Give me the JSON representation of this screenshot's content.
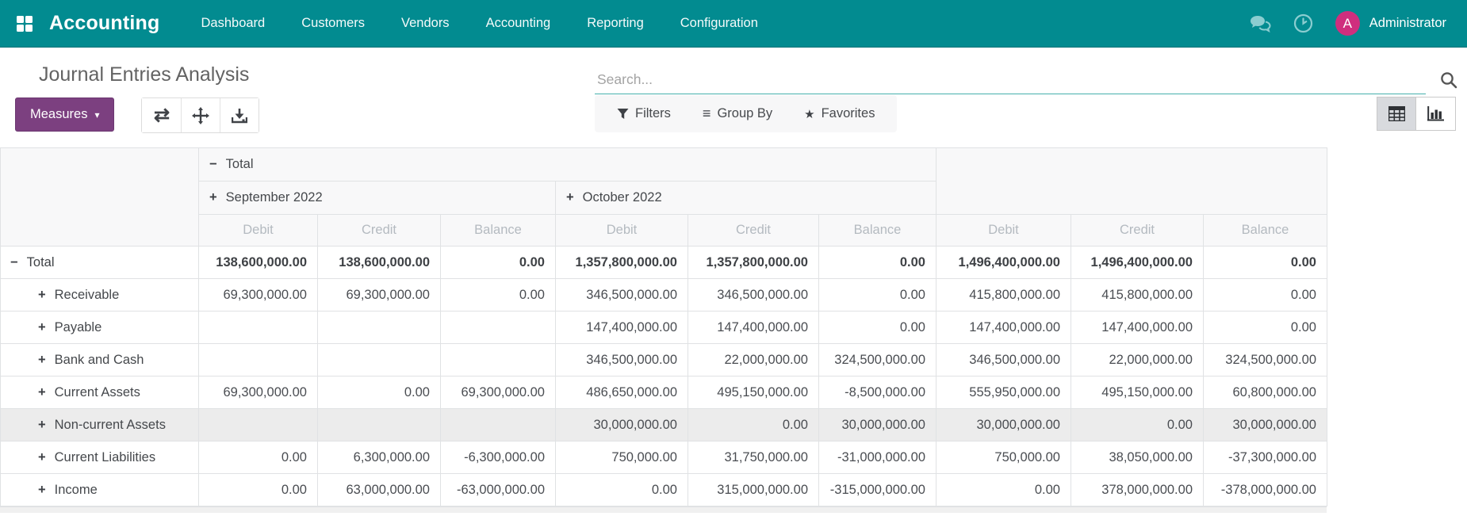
{
  "nav": {
    "brand": "Accounting",
    "items": [
      "Dashboard",
      "Customers",
      "Vendors",
      "Accounting",
      "Reporting",
      "Configuration"
    ],
    "user": {
      "initial": "A",
      "name": "Administrator"
    }
  },
  "control_panel": {
    "title": "Journal Entries Analysis",
    "measures_button": "Measures",
    "measures_caret": "▾",
    "search_placeholder": "Search...",
    "facets": {
      "filters": "Filters",
      "group_by": "Group By",
      "favorites": "Favorites"
    },
    "facet_glyphs": {
      "group_by": "≡",
      "favorites": "★"
    },
    "tool_glyphs": {
      "flip_axis": "⇄"
    }
  },
  "colors": {
    "navbar_teal": "#028b90",
    "primary_purple": "#7c4080",
    "avatar_pink": "#cf2e7e",
    "search_underline_teal": "#45b0ad",
    "highlight_row_gray": "#ececec"
  },
  "pivot": {
    "collapse_glyph": "−",
    "expand_glyph": "+",
    "col_root": {
      "label": "Total",
      "state": "collapse"
    },
    "col_groups": [
      {
        "label": "September 2022",
        "state": "expand"
      },
      {
        "label": "October 2022",
        "state": "expand"
      }
    ],
    "measures": [
      "Debit",
      "Credit",
      "Balance"
    ],
    "rows": [
      {
        "label": "Total",
        "state": "collapse",
        "indent": 0,
        "total": true,
        "highlighted": false,
        "values": [
          "138,600,000.00",
          "138,600,000.00",
          "0.00",
          "1,357,800,000.00",
          "1,357,800,000.00",
          "0.00",
          "1,496,400,000.00",
          "1,496,400,000.00",
          "0.00"
        ]
      },
      {
        "label": "Receivable",
        "state": "expand",
        "indent": 1,
        "total": false,
        "highlighted": false,
        "values": [
          "69,300,000.00",
          "69,300,000.00",
          "0.00",
          "346,500,000.00",
          "346,500,000.00",
          "0.00",
          "415,800,000.00",
          "415,800,000.00",
          "0.00"
        ]
      },
      {
        "label": "Payable",
        "state": "expand",
        "indent": 1,
        "total": false,
        "highlighted": false,
        "values": [
          "",
          "",
          "",
          "147,400,000.00",
          "147,400,000.00",
          "0.00",
          "147,400,000.00",
          "147,400,000.00",
          "0.00"
        ]
      },
      {
        "label": "Bank and Cash",
        "state": "expand",
        "indent": 1,
        "total": false,
        "highlighted": false,
        "values": [
          "",
          "",
          "",
          "346,500,000.00",
          "22,000,000.00",
          "324,500,000.00",
          "346,500,000.00",
          "22,000,000.00",
          "324,500,000.00"
        ]
      },
      {
        "label": "Current Assets",
        "state": "expand",
        "indent": 1,
        "total": false,
        "highlighted": false,
        "values": [
          "69,300,000.00",
          "0.00",
          "69,300,000.00",
          "486,650,000.00",
          "495,150,000.00",
          "-8,500,000.00",
          "555,950,000.00",
          "495,150,000.00",
          "60,800,000.00"
        ]
      },
      {
        "label": "Non-current Assets",
        "state": "expand",
        "indent": 1,
        "total": false,
        "highlighted": true,
        "values": [
          "",
          "",
          "",
          "30,000,000.00",
          "0.00",
          "30,000,000.00",
          "30,000,000.00",
          "0.00",
          "30,000,000.00"
        ]
      },
      {
        "label": "Current Liabilities",
        "state": "expand",
        "indent": 1,
        "total": false,
        "highlighted": false,
        "values": [
          "0.00",
          "6,300,000.00",
          "-6,300,000.00",
          "750,000.00",
          "31,750,000.00",
          "-31,000,000.00",
          "750,000.00",
          "38,050,000.00",
          "-37,300,000.00"
        ]
      },
      {
        "label": "Income",
        "state": "expand",
        "indent": 1,
        "total": false,
        "highlighted": false,
        "values": [
          "0.00",
          "63,000,000.00",
          "-63,000,000.00",
          "0.00",
          "315,000,000.00",
          "-315,000,000.00",
          "0.00",
          "378,000,000.00",
          "-378,000,000.00"
        ]
      }
    ]
  }
}
